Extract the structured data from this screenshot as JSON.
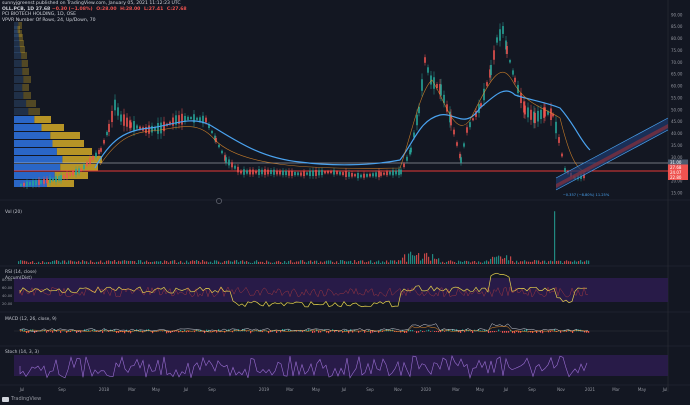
{
  "header": {
    "line1": "sunnyjgreenst published on TradingView.com, January 05, 2021 11:12:23 UTC",
    "symbol_line": "OLL.PCB, 1D",
    "price": "27.68",
    "change": "−0.30 (−1.08%)",
    "ohlc": [
      "O:28.00",
      "H:28.00",
      "L:27.41",
      "C:27.68"
    ],
    "overlay_title": "PCI BIOTECH HOLDING, 1D, OSE",
    "vprv_title": "VPVR Number Of Rows, 24, Up/Down, 70"
  },
  "price_axis": {
    "ticks": [
      "90.00",
      "85.00",
      "80.00",
      "75.00",
      "70.00",
      "65.00",
      "60.00",
      "55.00",
      "50.00",
      "45.00",
      "40.00",
      "35.00",
      "30.00",
      "25.00",
      "20.00",
      "15.00"
    ],
    "tick_values": [
      90,
      85,
      80,
      75,
      70,
      65,
      60,
      55,
      50,
      45,
      40,
      35,
      30,
      25,
      20,
      15
    ],
    "last_labels": [
      "31.00",
      "27.68",
      "24.07",
      "22.80"
    ]
  },
  "annotation": "−0.357 (−8.80%) 11.25%",
  "time_axis": [
    "Jul",
    "Sep",
    "2018",
    "Mar",
    "May",
    "Jul",
    "Sep",
    "2019",
    "Mar",
    "May",
    "Jul",
    "Sep",
    "Nov",
    "2020",
    "Mar",
    "May",
    "Jul",
    "Sep",
    "Nov",
    "2021",
    "Mar",
    "May",
    "Jul"
  ],
  "panels": {
    "vol": {
      "title": "Vol (20)"
    },
    "rsi": {
      "title": "RSI (14, close)",
      "subtitle": "Accum(Dist)",
      "ticks": [
        "80.00",
        "60.00",
        "40.00",
        "20.00"
      ]
    },
    "macd": {
      "title": "MACD (12, 26, close, 9)"
    },
    "stoch": {
      "title": "Stoch (14, 3, 3)"
    }
  },
  "footer": {
    "brand": "TradingView"
  },
  "colors": {
    "background": "#131722",
    "up": "#26a69a",
    "down": "#ef5350",
    "ma": "#4aa3f0",
    "vprv": "#c9a227",
    "rsi": "#e8d44d",
    "stoch": "#9b6fd4",
    "band": "#2b1c4d"
  }
}
